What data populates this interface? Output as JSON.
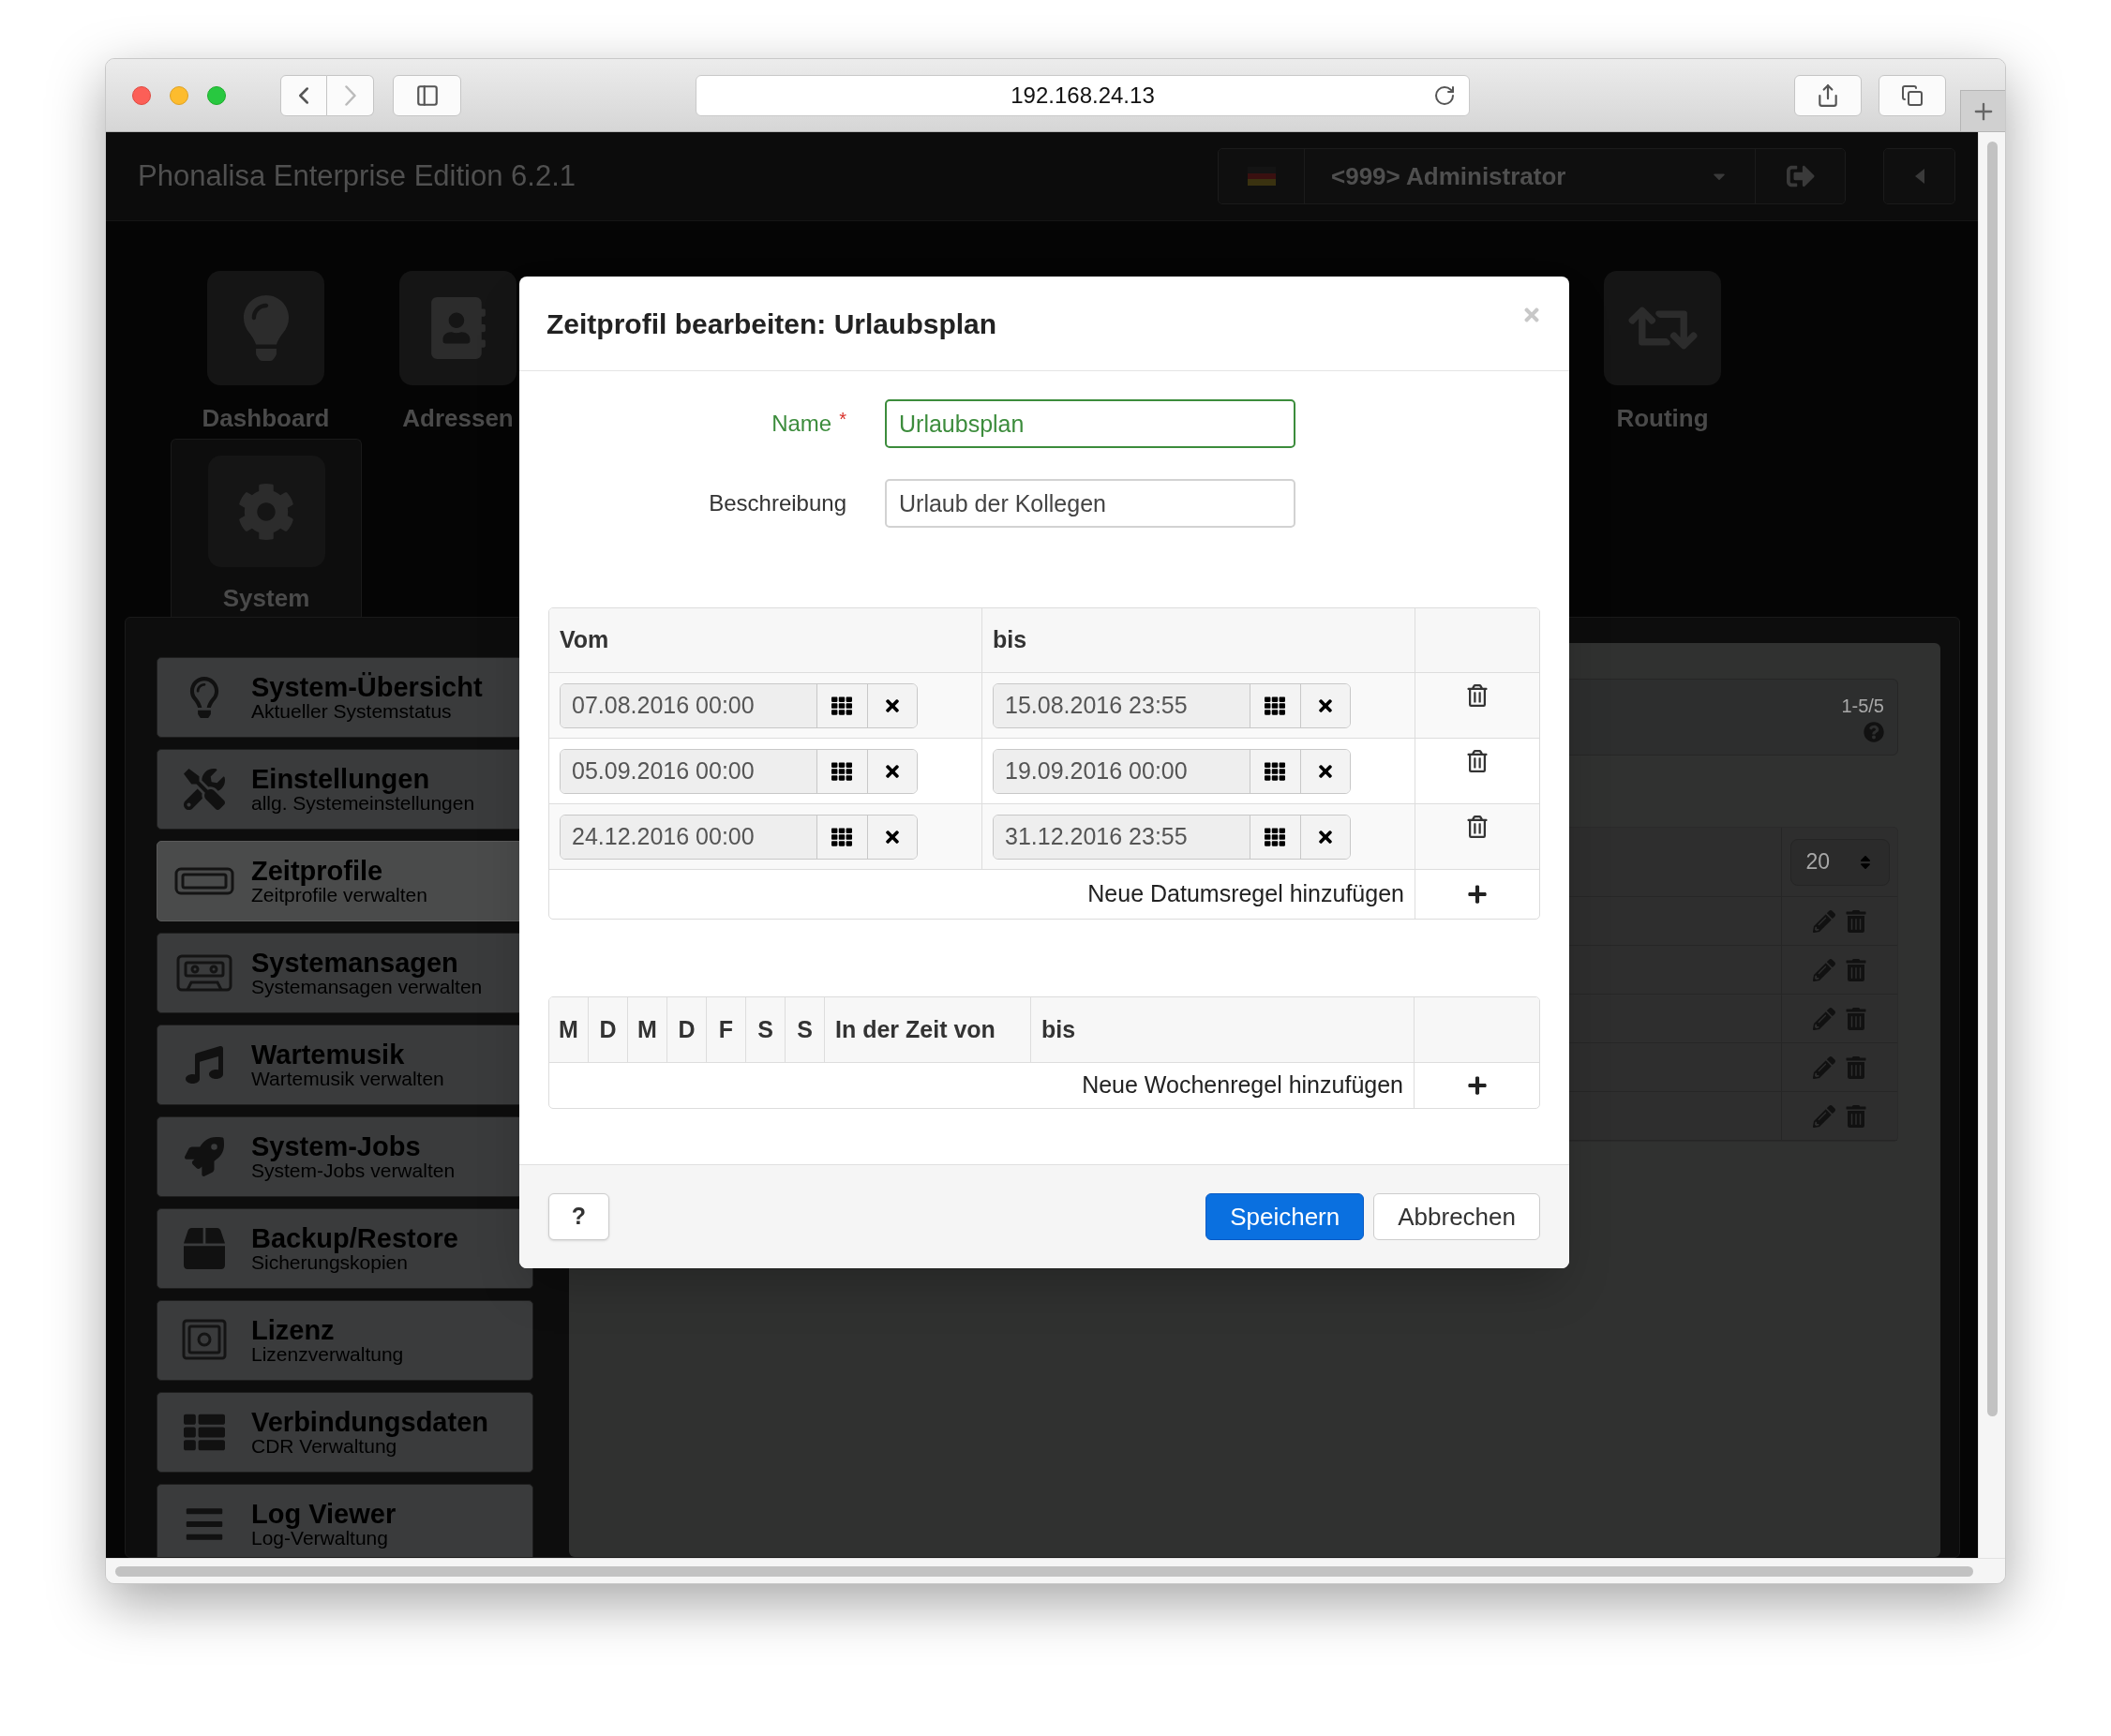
{
  "browser": {
    "url": "192.168.24.13"
  },
  "app": {
    "title": "Phonalisa Enterprise Edition 6.2.1",
    "user": "<999> Administrator"
  },
  "nav_tiles": [
    {
      "label": "Dashboard"
    },
    {
      "label": "Adressen"
    },
    {
      "label": "Routing"
    }
  ],
  "current_section": {
    "label": "System"
  },
  "sidebar": {
    "items": [
      {
        "title": "System-Übersicht",
        "subtitle": "Aktueller Systemstatus",
        "selected": false
      },
      {
        "title": "Einstellungen",
        "subtitle": "allg. Systemeinstellungen",
        "selected": false
      },
      {
        "title": "Zeitprofile",
        "subtitle": "Zeitprofile verwalten",
        "selected": true
      },
      {
        "title": "Systemansagen",
        "subtitle": "Systemansagen verwalten",
        "selected": false
      },
      {
        "title": "Wartemusik",
        "subtitle": "Wartemusik verwalten",
        "selected": false
      },
      {
        "title": "System-Jobs",
        "subtitle": "System-Jobs verwalten",
        "selected": false
      },
      {
        "title": "Backup/Restore",
        "subtitle": "Sicherungskopien",
        "selected": false
      },
      {
        "title": "Lizenz",
        "subtitle": "Lizenzverwaltung",
        "selected": false
      },
      {
        "title": "Verbindungsdaten",
        "subtitle": "CDR Verwaltung",
        "selected": false
      },
      {
        "title": "Log Viewer",
        "subtitle": "Log-Verwaltung",
        "selected": false
      }
    ]
  },
  "list_panel": {
    "range": "1-5/5",
    "page_size": "20"
  },
  "dialog": {
    "title": "Zeitprofil bearbeiten: Urlaubsplan",
    "fields": [
      {
        "label": "Name",
        "required_mark": "*",
        "value": "Urlaubsplan",
        "valid": true
      },
      {
        "label": "Beschreibung",
        "value": "Urlaub der Kollegen",
        "valid": false
      }
    ],
    "date_rules": {
      "columns": [
        "Vom",
        "bis"
      ],
      "rows": [
        {
          "from": "07.08.2016 00:00",
          "to": "15.08.2016 23:55"
        },
        {
          "from": "05.09.2016 00:00",
          "to": "19.09.2016 00:00"
        },
        {
          "from": "24.12.2016 00:00",
          "to": "31.12.2016 23:55"
        }
      ],
      "add_label": "Neue Datumsregel hinzufügen"
    },
    "week_rules": {
      "day_columns": [
        "M",
        "D",
        "M",
        "D",
        "F",
        "S",
        "S"
      ],
      "time_columns": [
        "In der Zeit von",
        "bis"
      ],
      "add_label": "Neue Wochenregel hinzufügen"
    },
    "buttons": [
      {
        "label": "?",
        "kind": "help"
      },
      {
        "label": "Speichern",
        "kind": "primary"
      },
      {
        "label": "Abbrechen",
        "kind": "default"
      }
    ]
  }
}
